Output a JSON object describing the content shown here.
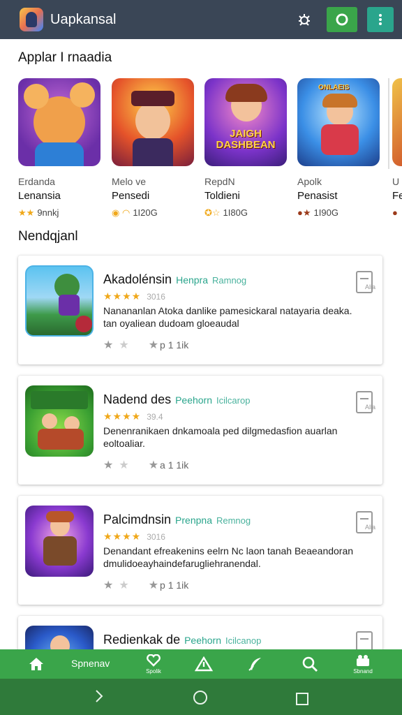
{
  "topbar": {
    "title": "Uapkansal",
    "icons": [
      "bug-icon",
      "refresh-icon",
      "more-icon"
    ]
  },
  "featured": {
    "title": "Applar I rnaadia",
    "items": [
      {
        "sub": "Erdanda",
        "name": "Lenansia",
        "rating": "9nnkj"
      },
      {
        "sub": "Melo ve",
        "name": "Pensedi",
        "rating": "1I20G"
      },
      {
        "sub": "RepdN",
        "name": "Toldieni",
        "rating": "1I80G"
      },
      {
        "sub": "Apolk",
        "name": "Penasist",
        "rating": "1I90G"
      },
      {
        "sub": "U",
        "name": "Fe",
        "rating": ""
      }
    ],
    "thumb_text": [
      "",
      "",
      "JAIGH DASHBEAN",
      "ONLAEIS",
      ""
    ]
  },
  "list": {
    "title": "Nendqjanl",
    "cards": [
      {
        "title": "Akadolénsin",
        "tag1": "Henpra",
        "tag2": "Ramnog",
        "stars": "★★★★",
        "rating_text": "3016",
        "desc": "Nanananlan Atoka danlike pamesickaral natayaria deaka. tan oyaliean dudoam gloeaudal",
        "foot": "p 1 1ik",
        "dl_label": "Alia"
      },
      {
        "title": "Nadend des",
        "tag1": "Peehorn",
        "tag2": "Icilcarop",
        "stars": "★★★★",
        "rating_text": "39.4",
        "desc": "Denenranikaen dnkamoala ped dilgmedasfion auarlan eoltoaliar.",
        "foot": "a 1 1ik",
        "dl_label": "Alla"
      },
      {
        "title": "Palcimdnsin",
        "tag1": "Prenpna",
        "tag2": "Remnog",
        "stars": "★★★★",
        "rating_text": "3016",
        "desc": "Denandant efreakenins eelrn Nc laon tanah Beaeandoran dmulidoeayhaindefarugliehranendal.",
        "foot": "p 1 1ik",
        "dl_label": "Alia"
      },
      {
        "title": "Redienkak de",
        "tag1": "Peehorn",
        "tag2": "Icilcanop",
        "stars": "★★★★",
        "rating_text": "",
        "desc": "",
        "foot": "",
        "dl_label": ""
      }
    ]
  },
  "bottom_nav": {
    "label": "Spnenav",
    "items": [
      {
        "icon": "home-icon",
        "label": ""
      },
      {
        "icon": "heart-icon",
        "label": "Spolik"
      },
      {
        "icon": "triangle-icon",
        "label": ""
      },
      {
        "icon": "feather-icon",
        "label": ""
      },
      {
        "icon": "search-icon",
        "label": ""
      },
      {
        "icon": "gift-icon",
        "label": "Sbnand"
      }
    ]
  },
  "colors": {
    "topbar": "#3a4656",
    "accent_green": "#3aa54a",
    "accent_teal": "#2aa58c",
    "star": "#f0a81a"
  }
}
